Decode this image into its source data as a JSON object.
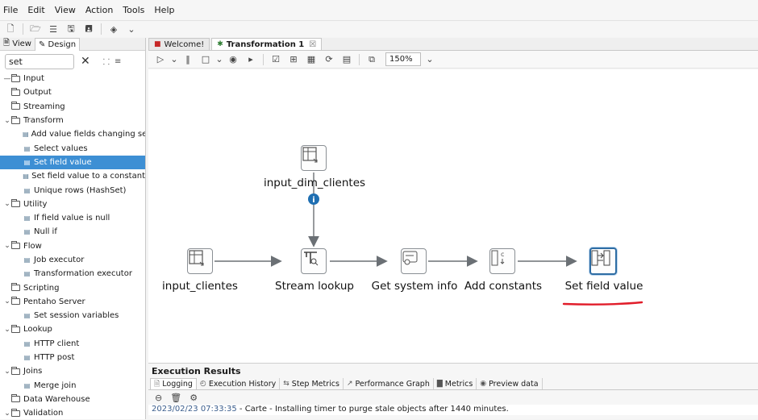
{
  "menu": [
    "File",
    "Edit",
    "View",
    "Action",
    "Tools",
    "Help"
  ],
  "left_panel": {
    "tabs": [
      "View",
      "Design"
    ],
    "search_value": "set",
    "tree": [
      {
        "label": "Input",
        "level": 0,
        "type": "folder",
        "toggle": "—"
      },
      {
        "label": "Output",
        "level": 0,
        "type": "folder",
        "toggle": ""
      },
      {
        "label": "Streaming",
        "level": 0,
        "type": "folder",
        "toggle": ""
      },
      {
        "label": "Transform",
        "level": 0,
        "type": "folder",
        "toggle": "⌄"
      },
      {
        "label": "Add value fields changing sequ",
        "level": 1,
        "type": "step"
      },
      {
        "label": "Select values",
        "level": 1,
        "type": "step"
      },
      {
        "label": "Set field value",
        "level": 1,
        "type": "step",
        "selected": true
      },
      {
        "label": "Set field value to a constant",
        "level": 1,
        "type": "step"
      },
      {
        "label": "Unique rows (HashSet)",
        "level": 1,
        "type": "step"
      },
      {
        "label": "Utility",
        "level": 0,
        "type": "folder",
        "toggle": "⌄"
      },
      {
        "label": "If field value is null",
        "level": 1,
        "type": "step"
      },
      {
        "label": "Null if",
        "level": 1,
        "type": "step"
      },
      {
        "label": "Flow",
        "level": 0,
        "type": "folder",
        "toggle": "⌄"
      },
      {
        "label": "Job executor",
        "level": 1,
        "type": "step"
      },
      {
        "label": "Transformation executor",
        "level": 1,
        "type": "step"
      },
      {
        "label": "Scripting",
        "level": 0,
        "type": "folder",
        "toggle": ""
      },
      {
        "label": "Pentaho Server",
        "level": 0,
        "type": "folder",
        "toggle": "⌄"
      },
      {
        "label": "Set session variables",
        "level": 1,
        "type": "step"
      },
      {
        "label": "Lookup",
        "level": 0,
        "type": "folder",
        "toggle": "⌄"
      },
      {
        "label": "HTTP client",
        "level": 1,
        "type": "step"
      },
      {
        "label": "HTTP post",
        "level": 1,
        "type": "step"
      },
      {
        "label": "Joins",
        "level": 0,
        "type": "folder",
        "toggle": "⌄"
      },
      {
        "label": "Merge join",
        "level": 1,
        "type": "step"
      },
      {
        "label": "Data Warehouse",
        "level": 0,
        "type": "folder",
        "toggle": ""
      },
      {
        "label": "Validation",
        "level": 0,
        "type": "folder",
        "toggle": "⌄"
      }
    ]
  },
  "editor_tabs": [
    {
      "label": "Welcome!",
      "active": false
    },
    {
      "label": "Transformation 1",
      "active": true
    }
  ],
  "zoom": "150%",
  "steps": [
    {
      "id": "input_dim_clientes",
      "label": "input_dim_clientes",
      "icon": "table-input-icon"
    },
    {
      "id": "input_clientes",
      "label": "input_clientes",
      "icon": "table-input-icon"
    },
    {
      "id": "stream_lookup",
      "label": "Stream lookup",
      "icon": "stream-lookup-icon"
    },
    {
      "id": "get_system_info",
      "label": "Get system info",
      "icon": "system-info-icon"
    },
    {
      "id": "add_constants",
      "label": "Add constants",
      "icon": "add-constants-icon"
    },
    {
      "id": "set_field_value",
      "label": "Set field value",
      "icon": "set-field-value-icon",
      "highlighted": true
    }
  ],
  "hop_info_symbol": "i",
  "execution": {
    "title": "Execution Results",
    "tabs": [
      "Logging",
      "Execution History",
      "Step Metrics",
      "Performance Graph",
      "Metrics",
      "Preview data"
    ],
    "log_lines": [
      {
        "time": "2023/02/23 07:33:35",
        "text": " - Carte - Installing timer to purge stale objects after 1440 minutes."
      }
    ]
  },
  "colors": {
    "selection": "#3d8fd4",
    "highlight_border": "#2e6da4",
    "underline": "#e11d2a",
    "info_dot": "#1f6fb2"
  }
}
